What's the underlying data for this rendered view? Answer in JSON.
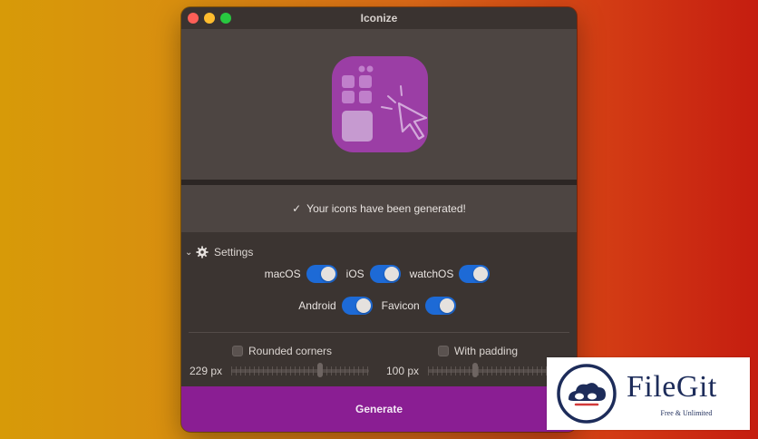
{
  "window": {
    "title": "Iconize"
  },
  "app_icon": {
    "name": "iconize-app-icon",
    "color": "#9b3ea5"
  },
  "status": {
    "check": "✓",
    "message": "Your icons have been generated!"
  },
  "settings": {
    "header": "Settings",
    "platforms_row1": [
      {
        "label": "macOS",
        "on": true
      },
      {
        "label": "iOS",
        "on": true
      },
      {
        "label": "watchOS",
        "on": true
      }
    ],
    "platforms_row2": [
      {
        "label": "Android",
        "on": true
      },
      {
        "label": "Favicon",
        "on": true
      }
    ],
    "rounded_corners": {
      "label": "Rounded corners",
      "checked": false,
      "value_label": "229 px",
      "slider_level": 0.65
    },
    "with_padding": {
      "label": "With padding",
      "checked": false,
      "value_label": "100 px",
      "slider_level": 0.38
    }
  },
  "generate": {
    "label": "Generate"
  },
  "watermark": {
    "name": "FileGit",
    "tagline": "Free & Unlimited"
  },
  "colors": {
    "accent_toggle": "#1d6ad6",
    "generate_bg": "#8a1e93"
  }
}
